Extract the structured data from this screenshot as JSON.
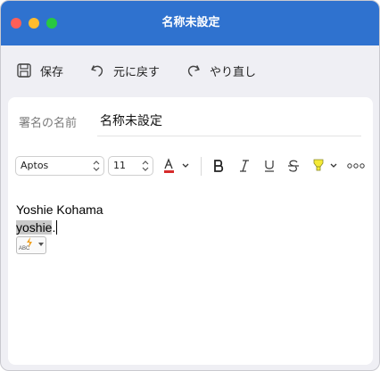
{
  "window": {
    "title": "名称未設定"
  },
  "toolbar": {
    "save_label": "保存",
    "undo_label": "元に戻す",
    "redo_label": "やり直し"
  },
  "signature": {
    "name_label": "署名の名前",
    "name_value": "名称未設定"
  },
  "format": {
    "font_family": "Aptos",
    "font_size": "11"
  },
  "editor": {
    "line1": "Yoshie Kohama",
    "line2_selected": "yoshie",
    "line2_rest": "."
  },
  "autocorrect": {
    "label": "ABC"
  },
  "colors": {
    "titlebar": "#2f72cf",
    "font_color_bar": "#d62b2b",
    "highlighter": "#f5ea36"
  },
  "icons": [
    "save-icon",
    "undo-icon",
    "redo-icon",
    "font-color-icon",
    "bold-icon",
    "italic-icon",
    "underline-icon",
    "strikethrough-icon",
    "highlighter-icon",
    "more-icon",
    "lightning-icon"
  ]
}
